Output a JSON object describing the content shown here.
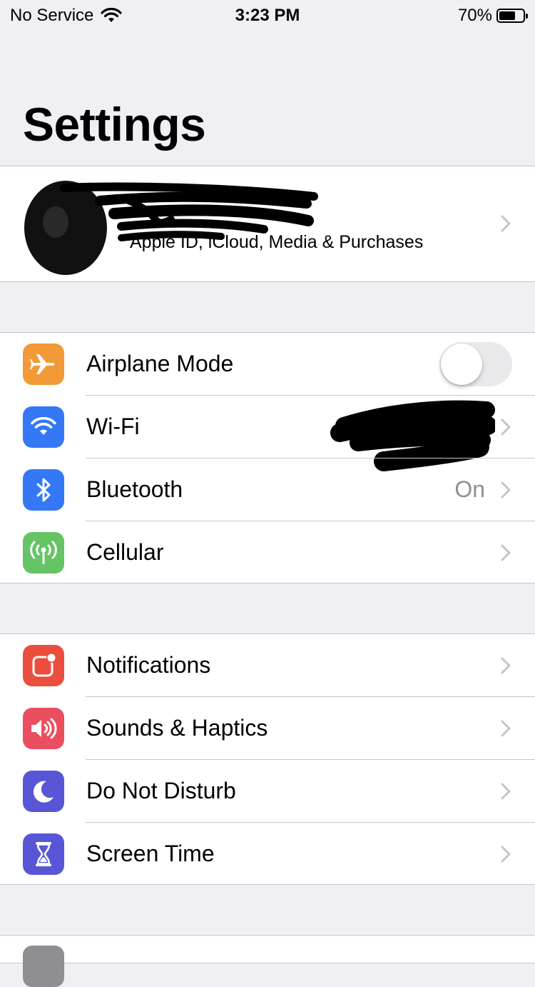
{
  "status_bar": {
    "carrier": "No Service",
    "time": "3:23 PM",
    "battery_percent": "70%",
    "battery_level": 0.7
  },
  "header": {
    "title": "Settings"
  },
  "profile": {
    "subtitle": "Apple ID, iCloud, Media & Purchases"
  },
  "group_connectivity": [
    {
      "label": "Airplane Mode",
      "icon": "airplane-icon",
      "color": "#f19a37",
      "toggle": false
    },
    {
      "label": "Wi-Fi",
      "icon": "wifi-icon",
      "color": "#3478f6",
      "value": ""
    },
    {
      "label": "Bluetooth",
      "icon": "bluetooth-icon",
      "color": "#3478f6",
      "value": "On"
    },
    {
      "label": "Cellular",
      "icon": "antenna-icon",
      "color": "#65c466",
      "value": ""
    }
  ],
  "group_notify": [
    {
      "label": "Notifications",
      "icon": "notifications-icon",
      "color": "#eb4e3d"
    },
    {
      "label": "Sounds & Haptics",
      "icon": "speaker-icon",
      "color": "#eb4e5f"
    },
    {
      "label": "Do Not Disturb",
      "icon": "moon-icon",
      "color": "#5856d6"
    },
    {
      "label": "Screen Time",
      "icon": "hourglass-icon",
      "color": "#5856d6"
    }
  ]
}
